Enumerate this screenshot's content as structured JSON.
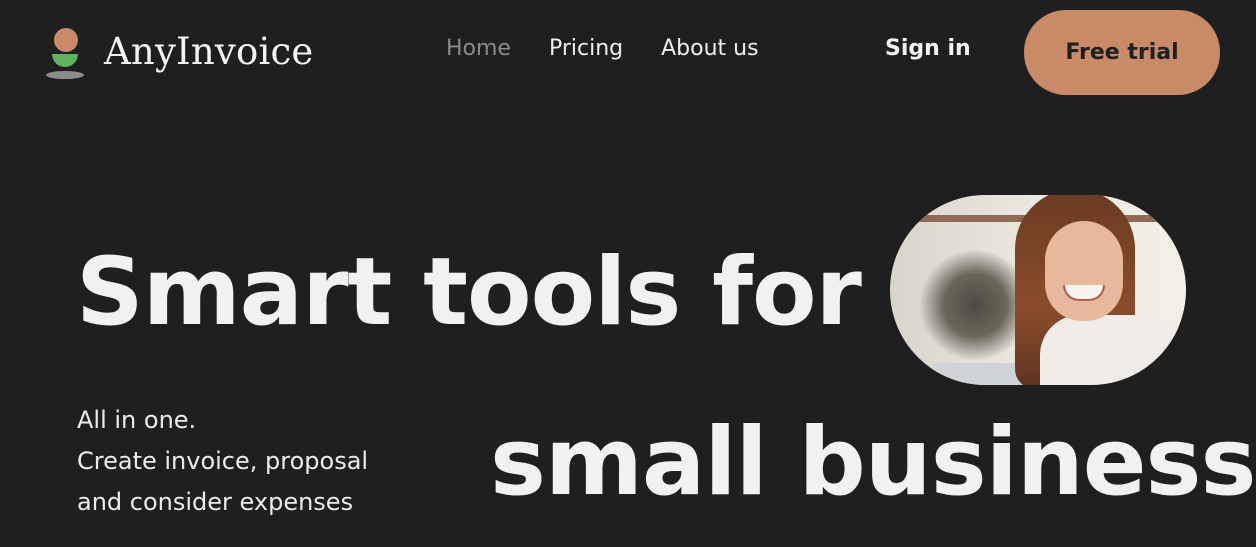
{
  "brand": {
    "name": "AnyInvoice",
    "colors": {
      "background": "#1f1f1f",
      "accent": "#c88a67",
      "logo_smile": "#5fb45e"
    }
  },
  "nav": {
    "items": [
      {
        "label": "Home",
        "active": true
      },
      {
        "label": "Pricing",
        "active": false
      },
      {
        "label": "About us",
        "active": false
      }
    ]
  },
  "actions": {
    "signin_label": "Sign in",
    "trial_label": "Free trial"
  },
  "hero": {
    "headline_line1": "Smart tools for",
    "headline_line2": "small business",
    "tagline": [
      "All in one.",
      "Create invoice, proposal",
      "and consider expenses"
    ],
    "photo_icon": "smiling-woman-photo"
  }
}
